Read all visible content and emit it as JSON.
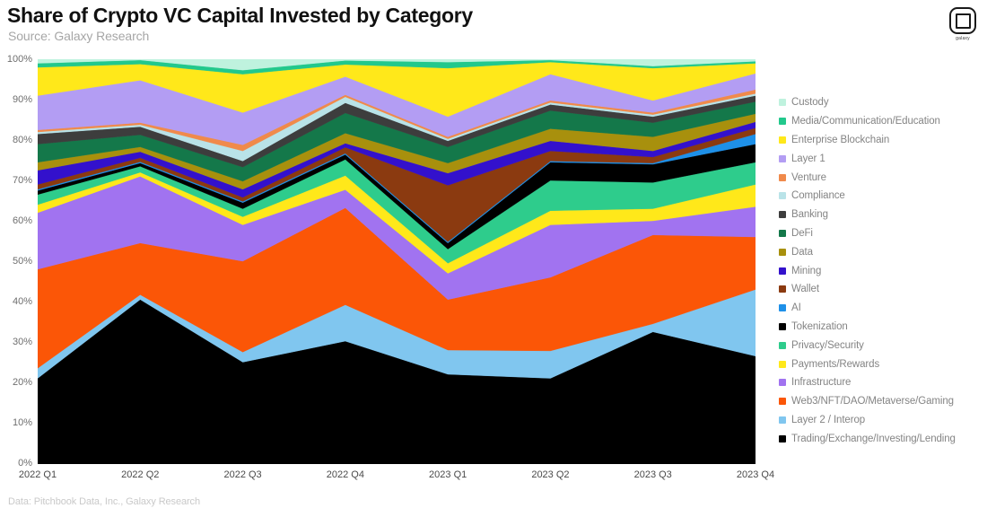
{
  "header": {
    "title": "Share of Crypto VC Capital Invested by Category",
    "subtitle": "Source: Galaxy Research"
  },
  "logo": {
    "name": "galaxy-logo",
    "text": "galaxy"
  },
  "footer": {
    "text": "Data: Pitchbook Data, Inc., Galaxy Research"
  },
  "chart_data": {
    "type": "area",
    "stacked": true,
    "normalized": true,
    "title": "Share of Crypto VC Capital Invested by Category",
    "subtitle": "Source: Galaxy Research",
    "xlabel": "",
    "ylabel": "",
    "ylim": [
      0,
      100
    ],
    "yticks": [
      "0%",
      "10%",
      "20%",
      "30%",
      "40%",
      "50%",
      "60%",
      "70%",
      "80%",
      "90%",
      "100%"
    ],
    "ytick_values": [
      0,
      10,
      20,
      30,
      40,
      50,
      60,
      70,
      80,
      90,
      100
    ],
    "grid": false,
    "legend_position": "right",
    "categories": [
      "2022 Q1",
      "2022 Q2",
      "2022 Q3",
      "2022 Q4",
      "2023 Q1",
      "2023 Q2",
      "2023 Q3",
      "2023 Q4"
    ],
    "series": [
      {
        "name": "Trading/Exchange/Investing/Lending",
        "color": "#000000",
        "values": [
          21.0,
          40.5,
          25.0,
          30.2,
          22.0,
          21.0,
          32.5,
          26.5
        ]
      },
      {
        "name": "Layer 2 / Interop",
        "color": "#80C6EF",
        "values": [
          2.5,
          1.2,
          2.5,
          9.0,
          6.0,
          6.8,
          2.0,
          16.5
        ]
      },
      {
        "name": "Web3/NFT/DAO/Metaverse/Gaming",
        "color": "#FB5607",
        "values": [
          24.5,
          12.8,
          22.5,
          24.0,
          12.5,
          18.2,
          22.0,
          13.0
        ]
      },
      {
        "name": "Infrastructure",
        "color": "#A173F0",
        "values": [
          14.0,
          16.5,
          9.0,
          4.5,
          6.5,
          13.0,
          3.5,
          7.5
        ]
      },
      {
        "name": "Payments/Rewards",
        "color": "#FFE81A",
        "values": [
          2.0,
          1.0,
          2.0,
          3.5,
          2.5,
          3.5,
          3.0,
          5.5
        ]
      },
      {
        "name": "Privacy/Security",
        "color": "#2ECC8C",
        "values": [
          2.5,
          1.5,
          2.0,
          4.0,
          3.5,
          7.5,
          6.5,
          5.5
        ]
      },
      {
        "name": "Tokenization",
        "color": "#000000",
        "values": [
          1.0,
          0.8,
          1.5,
          1.2,
          1.5,
          4.5,
          4.5,
          4.5
        ]
      },
      {
        "name": "AI",
        "color": "#1E90E8",
        "values": [
          0.3,
          0.3,
          0.3,
          0.3,
          0.3,
          0.3,
          0.3,
          2.5
        ]
      },
      {
        "name": "Wallet",
        "color": "#8B3A10",
        "values": [
          1.2,
          1.0,
          1.0,
          1.5,
          14.0,
          2.5,
          1.5,
          1.5
        ]
      },
      {
        "name": "Mining",
        "color": "#3311CC",
        "values": [
          3.5,
          1.5,
          2.0,
          1.0,
          3.0,
          2.5,
          1.5,
          1.5
        ]
      },
      {
        "name": "Data",
        "color": "#A8900D",
        "values": [
          2.0,
          1.2,
          2.0,
          2.5,
          2.5,
          3.0,
          3.5,
          2.0
        ]
      },
      {
        "name": "DeFi",
        "color": "#14784A",
        "values": [
          4.5,
          3.0,
          3.5,
          5.0,
          4.0,
          4.5,
          3.5,
          3.0
        ]
      },
      {
        "name": "Banking",
        "color": "#3D3D3D",
        "values": [
          2.5,
          2.0,
          1.5,
          2.5,
          1.5,
          1.5,
          1.5,
          1.5
        ]
      },
      {
        "name": "Compliance",
        "color": "#B9E3E8",
        "values": [
          0.5,
          0.5,
          2.5,
          1.5,
          0.5,
          0.5,
          0.5,
          0.5
        ]
      },
      {
        "name": "Venture",
        "color": "#F08A4B",
        "values": [
          0.5,
          0.5,
          1.5,
          0.5,
          0.5,
          0.5,
          0.5,
          1.0
        ]
      },
      {
        "name": "Layer 1",
        "color": "#B39DF3",
        "values": [
          8.5,
          10.5,
          8.0,
          4.5,
          5.0,
          6.5,
          3.0,
          4.0
        ]
      },
      {
        "name": "Enterprise Blockchain",
        "color": "#FFE81A",
        "values": [
          7.0,
          4.0,
          9.5,
          3.0,
          12.0,
          3.0,
          8.0,
          2.5
        ]
      },
      {
        "name": "Media/Communication/Education",
        "color": "#22C88C",
        "values": [
          1.0,
          1.0,
          1.0,
          1.0,
          1.5,
          0.5,
          0.5,
          0.5
        ]
      },
      {
        "name": "Custody",
        "color": "#BFF2DE",
        "values": [
          1.0,
          0.2,
          2.7,
          0.3,
          0.7,
          0.2,
          1.7,
          0.5
        ]
      }
    ],
    "legend_entries": [
      {
        "label": "Custody",
        "color": "#BFF2DE"
      },
      {
        "label": "Media/Communication/Education",
        "color": "#22C88C"
      },
      {
        "label": "Enterprise Blockchain",
        "color": "#FFE81A"
      },
      {
        "label": "Layer 1",
        "color": "#B39DF3"
      },
      {
        "label": "Venture",
        "color": "#F08A4B"
      },
      {
        "label": "Compliance",
        "color": "#B9E3E8"
      },
      {
        "label": "Banking",
        "color": "#3D3D3D"
      },
      {
        "label": "DeFi",
        "color": "#14784A"
      },
      {
        "label": "Data",
        "color": "#A8900D"
      },
      {
        "label": "Mining",
        "color": "#3311CC"
      },
      {
        "label": "Wallet",
        "color": "#8B3A10"
      },
      {
        "label": "AI",
        "color": "#1E90E8"
      },
      {
        "label": "Tokenization",
        "color": "#000000"
      },
      {
        "label": "Privacy/Security",
        "color": "#2ECC8C"
      },
      {
        "label": "Payments/Rewards",
        "color": "#FFE81A"
      },
      {
        "label": "Infrastructure",
        "color": "#A173F0"
      },
      {
        "label": "Web3/NFT/DAO/Metaverse/Gaming",
        "color": "#FB5607"
      },
      {
        "label": "Layer 2 / Interop",
        "color": "#80C6EF"
      },
      {
        "label": "Trading/Exchange/Investing/Lending",
        "color": "#000000"
      }
    ]
  }
}
